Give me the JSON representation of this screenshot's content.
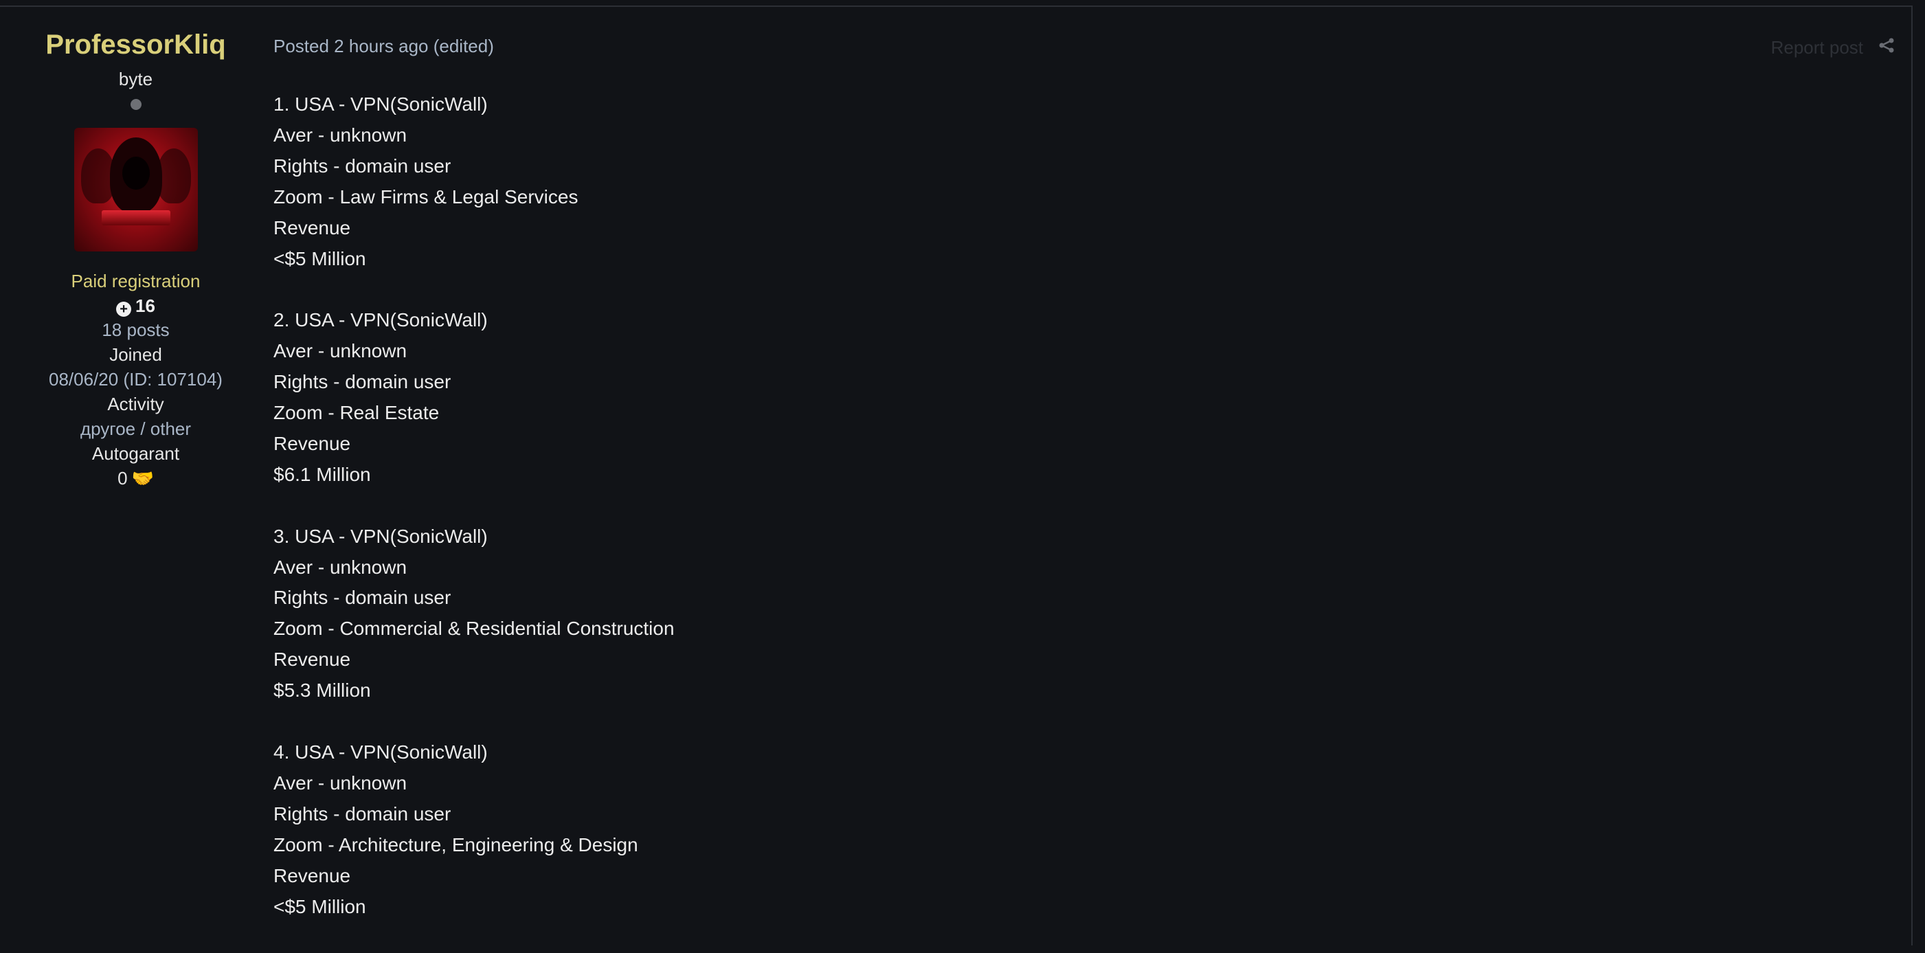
{
  "author": {
    "username": "ProfessorKliq",
    "rank": "byte",
    "group": "Paid registration",
    "reputation": "16",
    "posts": "18 posts",
    "joined_label": "Joined",
    "joined_value": "08/06/20 (ID: 107104)",
    "activity_label": "Activity",
    "activity_value": "другое / other",
    "autogarant_label": "Autogarant",
    "autogarant_value": "0"
  },
  "post": {
    "meta": "Posted 2 hours ago (edited)",
    "report_label": "Report post",
    "blocks": [
      [
        "1. USA - VPN(SonicWall)",
        "Aver - unknown",
        "Rights - domain user",
        "Zoom - Law Firms & Legal Services",
        "Revenue",
        "<$5 Million"
      ],
      [
        "2. USA - VPN(SonicWall)",
        "Aver - unknown",
        "Rights - domain user",
        "Zoom - Real Estate",
        "Revenue",
        "$6.1 Million"
      ],
      [
        "3. USA - VPN(SonicWall)",
        "Aver - unknown",
        "Rights - domain user",
        "Zoom - Commercial & Residential Construction",
        "Revenue",
        "$5.3 Million"
      ],
      [
        "4. USA - VPN(SonicWall)",
        "Aver - unknown",
        "Rights - domain user",
        "Zoom - Architecture, Engineering & Design",
        "Revenue",
        "<$5 Million"
      ]
    ]
  },
  "icons": {
    "status": "offline-status-dot",
    "reputation": "plus-circle-icon",
    "autogarant": "handshake-icon",
    "share": "share-icon"
  },
  "colors": {
    "background": "#111317",
    "username": "#d9cf7a",
    "link": "#a9b6c7",
    "text": "#ececec"
  }
}
